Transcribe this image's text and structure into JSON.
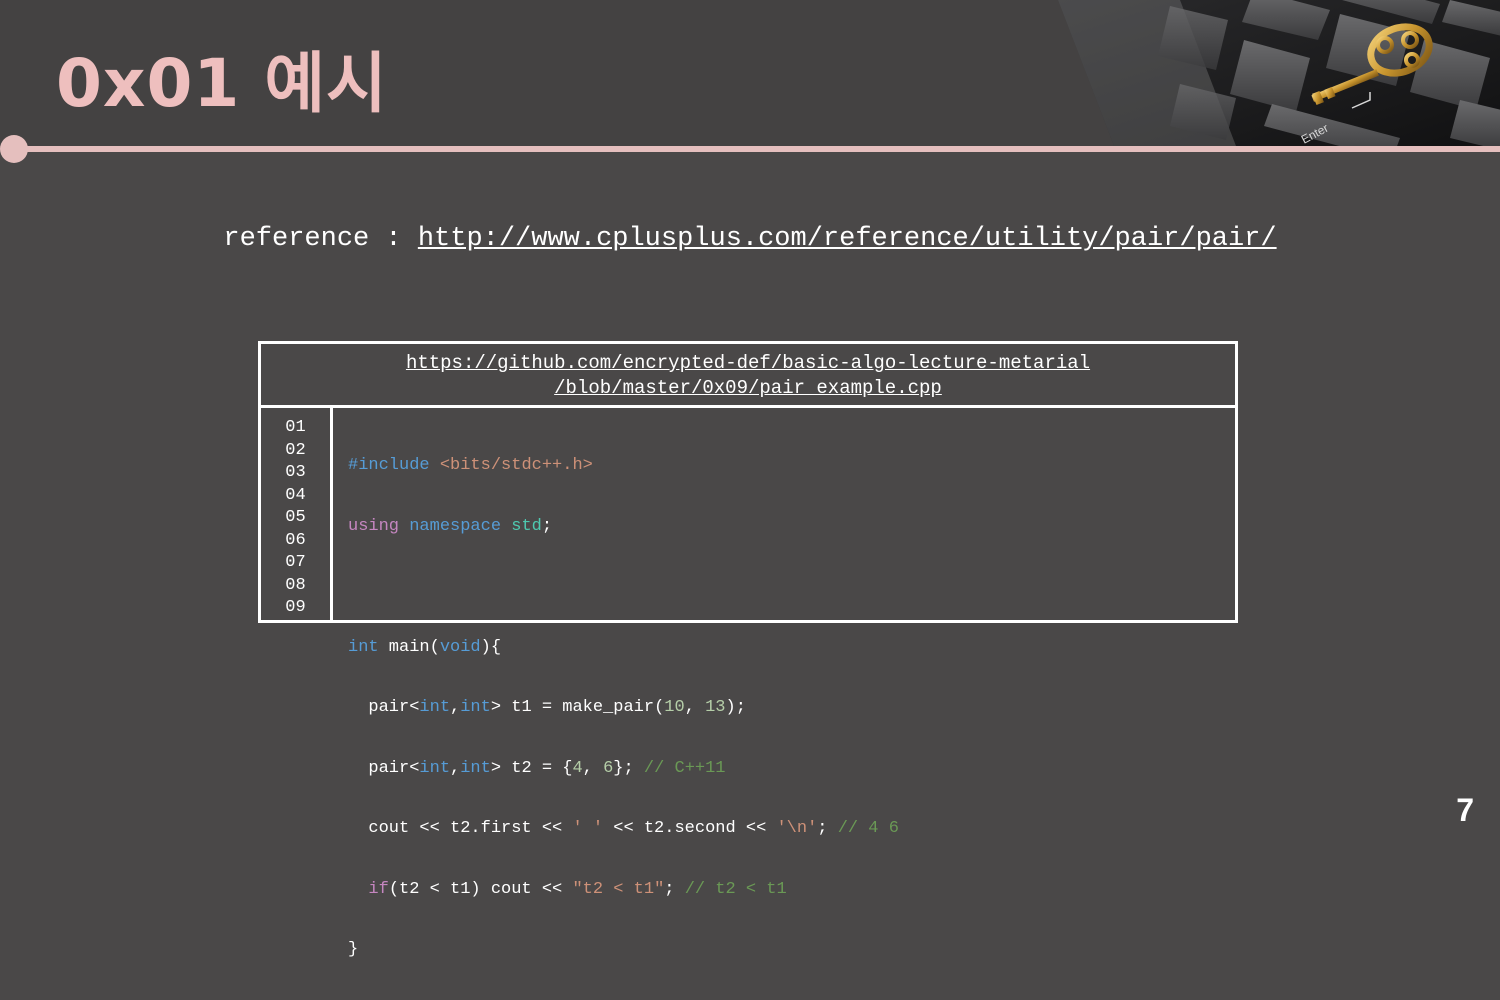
{
  "slide": {
    "title": "0x01 예시",
    "page_number": "7",
    "photo_key_label": "Enter"
  },
  "reference": {
    "label": "reference : ",
    "url": "http://www.cplusplus.com/reference/utility/pair/pair/"
  },
  "codebox": {
    "url_line1": "https://github.com/encrypted-def/basic-algo-lecture-metarial",
    "url_line2": "/blob/master/0x09/pair_example.cpp",
    "line_numbers": [
      "01",
      "02",
      "03",
      "04",
      "05",
      "06",
      "07",
      "08",
      "09"
    ]
  },
  "code_tokens": {
    "l1_a": "#include",
    "l1_b": " <bits/stdc++.h>",
    "l2_a": "using",
    "l2_b": "namespace",
    "l2_c": "std",
    "l2_d": ";",
    "l4_a": "int",
    "l4_b": " main(",
    "l4_c": "void",
    "l4_d": "){",
    "l5_a": "  pair<",
    "l5_b": "int",
    "l5_c": ",",
    "l5_d": "int",
    "l5_e": "> t1 = make_pair(",
    "l5_f": "10",
    "l5_g": ", ",
    "l5_h": "13",
    "l5_i": ");",
    "l6_a": "  pair<",
    "l6_b": "int",
    "l6_c": ",",
    "l6_d": "int",
    "l6_e": "> t2 = {",
    "l6_f": "4",
    "l6_g": ", ",
    "l6_h": "6",
    "l6_i": "}; ",
    "l6_j": "// C++11",
    "l7_a": "  cout << t2.first << ",
    "l7_b": "' '",
    "l7_c": " << t2.second << ",
    "l7_d": "'\\n'",
    "l7_e": "; ",
    "l7_f": "// 4 6",
    "l8_a": "  ",
    "l8_b": "if",
    "l8_c": "(t2 < t1) cout << ",
    "l8_d": "\"t2 < t1\"",
    "l8_e": "; ",
    "l8_f": "// t2 < t1",
    "l9_a": "}"
  },
  "colors": {
    "accent_pink": "#e5bfbe",
    "background": "#4a4848",
    "keyword_blue": "#569cd6",
    "keyword_pink": "#c586c0",
    "string": "#ce9178",
    "number": "#b5cea8",
    "comment": "#6a9955"
  }
}
